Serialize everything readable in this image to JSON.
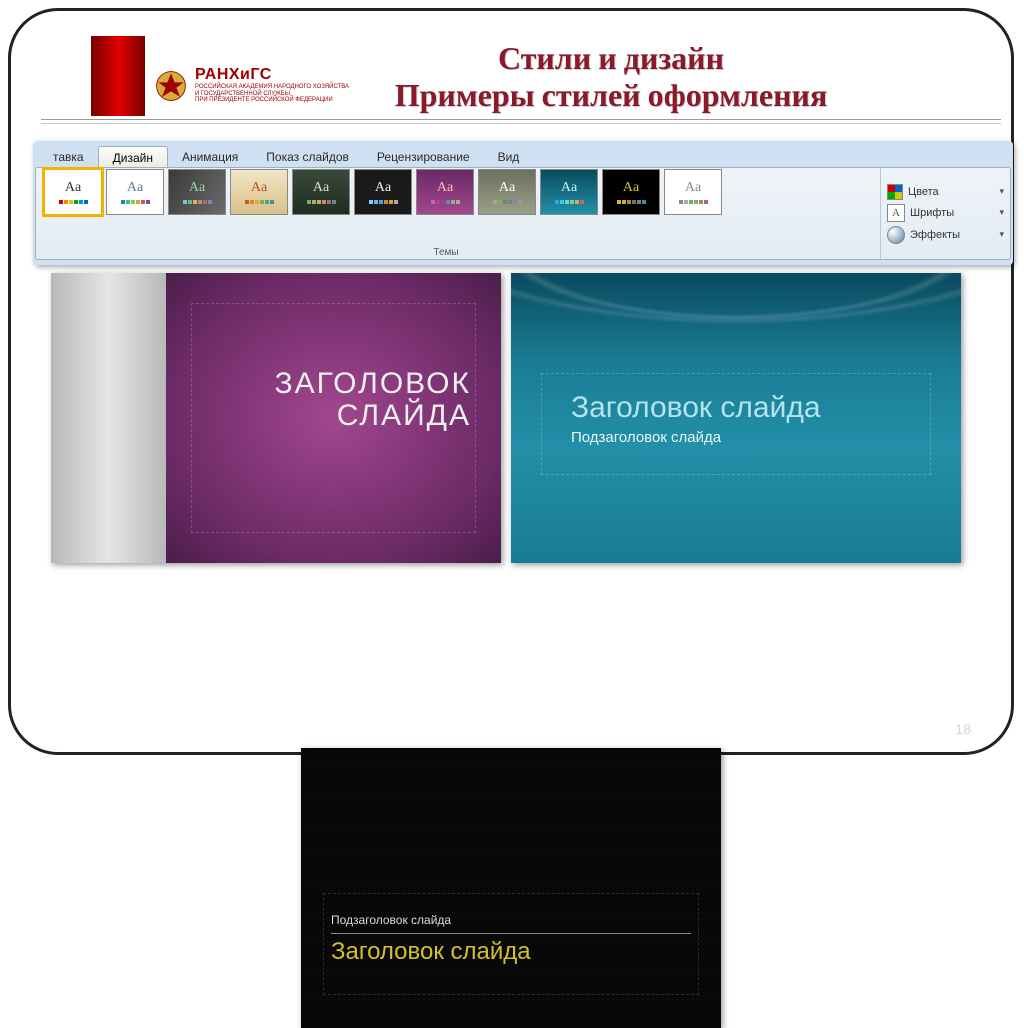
{
  "logo": {
    "name": "РАНХиГС",
    "sub1": "РОССИЙСКАЯ АКАДЕМИЯ НАРОДНОГО ХОЗЯЙСТВА",
    "sub2": "И ГОСУДАРСТВЕННОЙ СЛУЖБЫ",
    "sub3": "ПРИ ПРЕЗИДЕНТЕ РОССИЙСКОЙ ФЕДЕРАЦИИ"
  },
  "title": {
    "line1": "Стили и дизайн",
    "line2": "Примеры стилей оформления"
  },
  "ribbon": {
    "tabs": [
      {
        "label": "тавка",
        "active": false
      },
      {
        "label": "Дизайн",
        "active": true
      },
      {
        "label": "Анимация",
        "active": false
      },
      {
        "label": "Показ слайдов",
        "active": false
      },
      {
        "label": "Рецензирование",
        "active": false
      },
      {
        "label": "Вид",
        "active": false
      }
    ],
    "themes_group_label": "Темы",
    "aa": "Aa",
    "right": {
      "colors": "Цвета",
      "fonts": "Шрифты",
      "effects": "Эффекты",
      "font_glyph": "A"
    }
  },
  "examples": {
    "purple": {
      "title_line1": "ЗАГОЛОВОК",
      "title_line2": "СЛАЙДА"
    },
    "teal": {
      "title": "Заголовок слайда",
      "subtitle": "Подзаголовок слайда"
    },
    "black": {
      "subtitle": "Подзаголовок слайда",
      "title": "Заголовок слайда"
    }
  },
  "page_number": "18"
}
